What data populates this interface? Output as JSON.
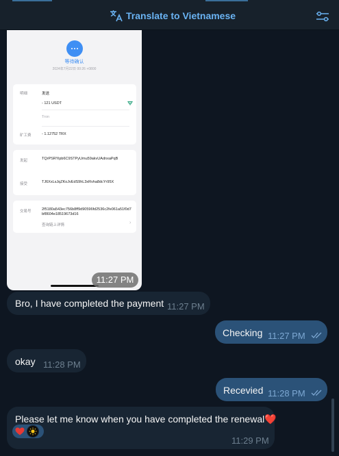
{
  "header": {
    "translate_label": "Translate to Vietnamese",
    "translate_icon": "translate-icon",
    "filter_icon": "sliders-icon",
    "accent_color": "#6ab3f3"
  },
  "screenshot": {
    "status_label": "等待确认",
    "status_date": "2024年7月22日 00:26 +0800",
    "detail_label": "明细",
    "send_label": "发送",
    "amount": "- 121 USDT",
    "network": "Tron",
    "fee_label": "矿工费",
    "fee_value": "- 1.12752 TRX",
    "from_label": "发起",
    "from_address": "TQrPSRYipb6C9STPyUmu59akvUAdnxaPqB",
    "to_label": "接受",
    "to_address": "TJ6XxLsJqZKoJvEdS9hL3xRvha8dcYr95X",
    "txid_label": "交易号",
    "txid": "2f5180a543ec756b8ff9d90596fd2536c2fe061a51f0d7bf8604e18519673d16",
    "chain_link": "查询链上详情",
    "time": "11:27 PM"
  },
  "messages": [
    {
      "direction": "incoming",
      "text": "Bro, I have completed the payment",
      "time": "11:27 PM"
    },
    {
      "direction": "outgoing",
      "text": "Checking",
      "time": "11:27 PM",
      "read": true
    },
    {
      "direction": "incoming",
      "text": "okay",
      "time": "11:28 PM"
    },
    {
      "direction": "outgoing",
      "text": "Recevied",
      "time": "11:28 PM",
      "read": true
    },
    {
      "direction": "incoming",
      "text": "Please let me know when you have completed the renewal",
      "emoji": "❤️",
      "time": "11:29 PM",
      "reactions": [
        "❤️"
      ]
    }
  ],
  "colors": {
    "background": "#0e1621",
    "incoming_bubble": "#182533",
    "outgoing_bubble": "#2b5278",
    "heart": "#e53935"
  }
}
